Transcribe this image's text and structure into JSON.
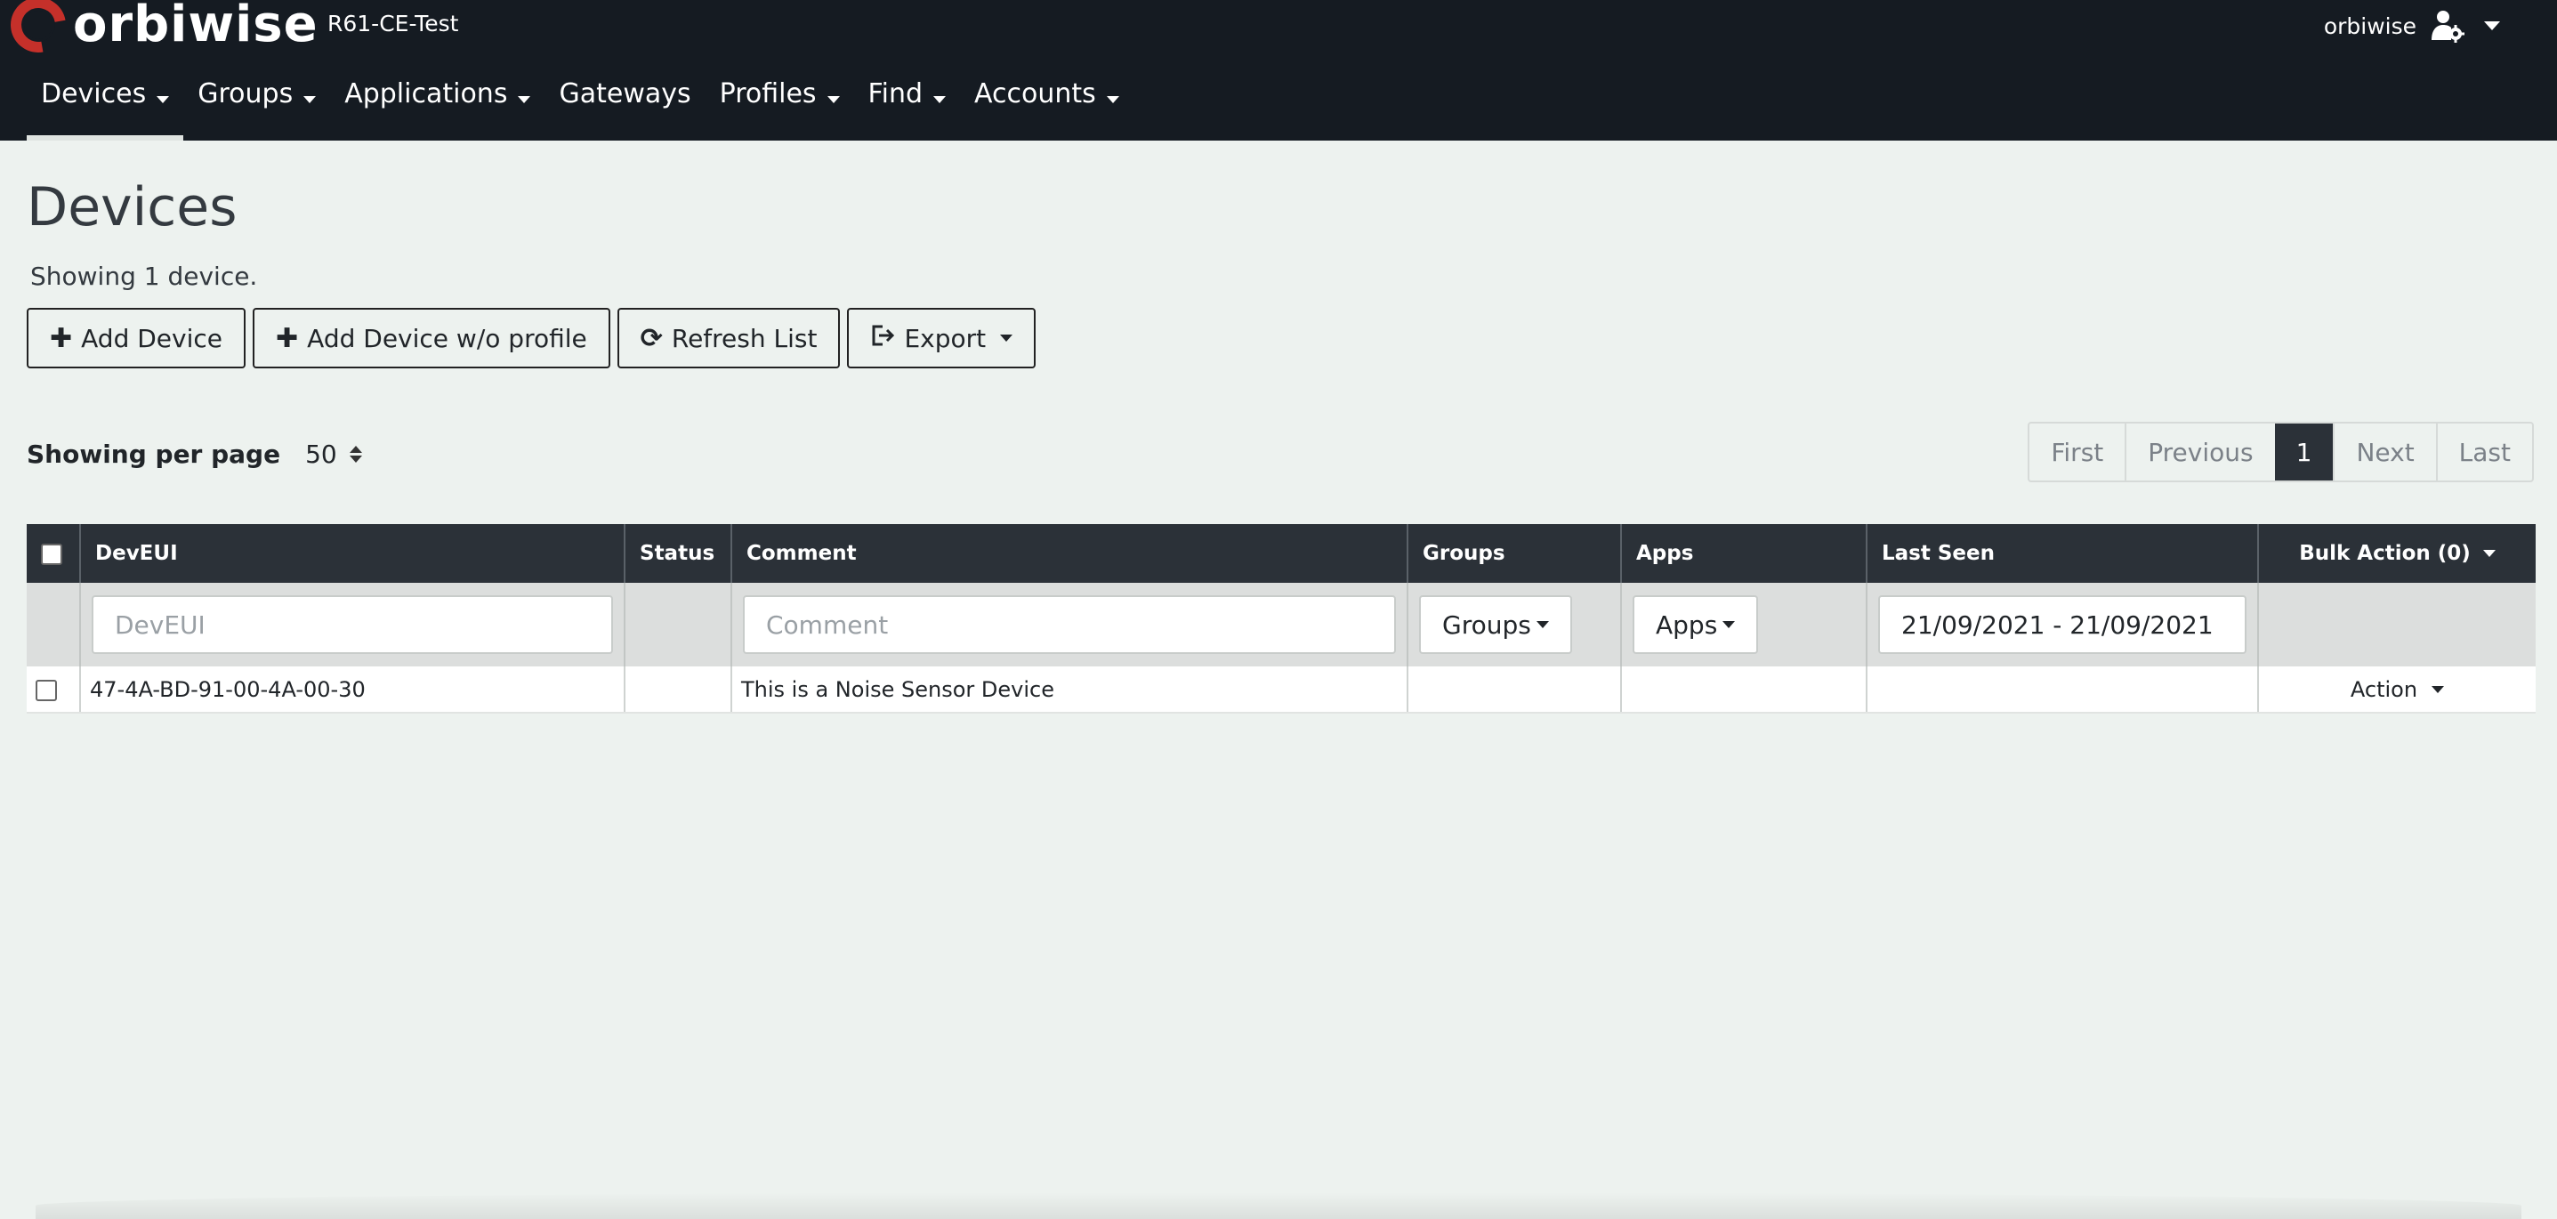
{
  "app": {
    "brand": "orbiwise",
    "instance": "R61-CE-Test",
    "user": "orbiwise",
    "accent_color": "#c5302a",
    "header_bg": "#151b22"
  },
  "nav": [
    {
      "label": "Devices",
      "has_menu": true,
      "active": true
    },
    {
      "label": "Groups",
      "has_menu": true
    },
    {
      "label": "Applications",
      "has_menu": true
    },
    {
      "label": "Gateways",
      "has_menu": false
    },
    {
      "label": "Profiles",
      "has_menu": true
    },
    {
      "label": "Find",
      "has_menu": true
    },
    {
      "label": "Accounts",
      "has_menu": true
    }
  ],
  "page": {
    "title": "Devices",
    "count_text": "Showing 1 device."
  },
  "toolbar": {
    "add_device": "Add Device",
    "add_device_no_profile": "Add Device w/o profile",
    "refresh": "Refresh List",
    "export": "Export"
  },
  "perpage": {
    "label": "Showing per page",
    "value": "50"
  },
  "pager": {
    "first": "First",
    "previous": "Previous",
    "current": "1",
    "next": "Next",
    "last": "Last"
  },
  "table": {
    "headers": {
      "deveui": "DevEUI",
      "status": "Status",
      "comment": "Comment",
      "groups": "Groups",
      "apps": "Apps",
      "last_seen": "Last Seen",
      "bulk_action": "Bulk Action (0)"
    },
    "filters": {
      "deveui_placeholder": "DevEUI",
      "comment_placeholder": "Comment",
      "groups_label": "Groups",
      "apps_label": "Apps",
      "date_range": "21/09/2021 - 21/09/2021"
    },
    "rows": [
      {
        "deveui": "47-4A-BD-91-00-4A-00-30",
        "status": "",
        "comment": "This is a Noise Sensor Device",
        "groups": "",
        "apps": "",
        "last_seen": "",
        "action": "Action"
      }
    ]
  }
}
